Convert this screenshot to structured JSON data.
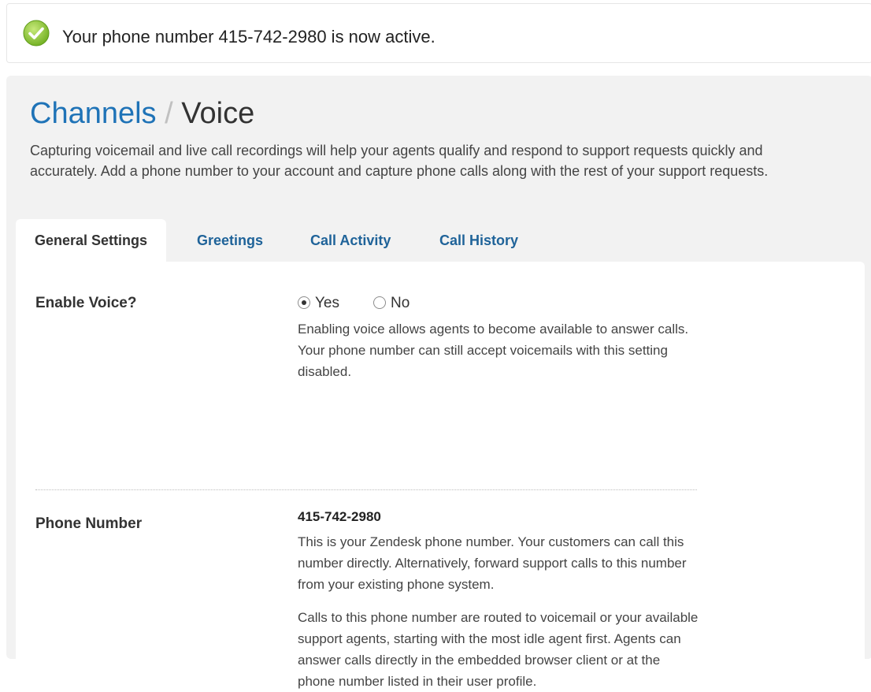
{
  "notice": {
    "message": "Your phone number 415-742-2980 is now active.",
    "icon": "check-circle-icon",
    "icon_color": "#8cc63f"
  },
  "header": {
    "breadcrumb_parent": "Channels",
    "breadcrumb_separator": "/",
    "title": "Voice",
    "intro": "Capturing voicemail and live call recordings will help your agents qualify and respond to support requests quickly and accurately. Add a phone number to your account and capture phone calls along with the rest of your support requests."
  },
  "tabs": [
    {
      "label": "General Settings",
      "active": true
    },
    {
      "label": "Greetings",
      "active": false
    },
    {
      "label": "Call Activity",
      "active": false
    },
    {
      "label": "Call History",
      "active": false
    }
  ],
  "settings": {
    "enable_voice": {
      "label": "Enable Voice?",
      "options": [
        {
          "label": "Yes",
          "selected": true
        },
        {
          "label": "No",
          "selected": false
        }
      ],
      "description": "Enabling voice allows agents to become available to answer calls. Your phone number can still accept voicemails with this setting disabled."
    },
    "phone_number": {
      "label": "Phone Number",
      "value": "415-742-2980",
      "description": "This is your Zendesk phone number. Your customers can call this number directly. Alternatively, forward support calls to this number from your existing phone system.",
      "description2": "Calls to this phone number are routed to voicemail or your available support agents, starting with the most idle agent first. Agents can answer calls directly in the embedded browser client or at the phone number listed in their user profile."
    }
  },
  "colors": {
    "link": "#1f73b7",
    "panel_bg": "#f2f2f2"
  }
}
